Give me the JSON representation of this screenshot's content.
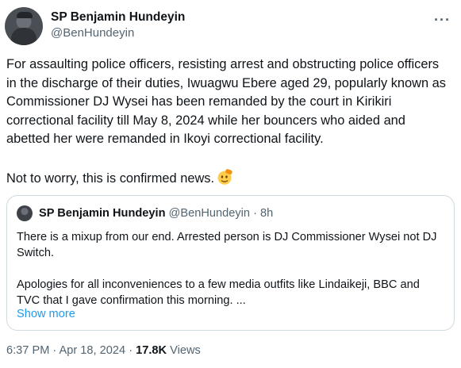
{
  "author": {
    "name": "SP Benjamin Hundeyin",
    "handle": "@BenHundeyin",
    "more_icon": "more-horizontal-icon"
  },
  "tweet": {
    "text": "For assaulting police officers, resisting arrest and obstructing police officers in the discharge of their duties, Iwuagwu Ebere aged 29, popularly known as Commissioner DJ Wysei has been remanded by the court in Kirikiri correctional facility till May 8, 2024 while her bouncers who aided and abetted her were remanded in Ikoyi correctional facility.\n\nNot to worry, this is confirmed news.",
    "emoji": "saluting-face-emoji"
  },
  "quoted": {
    "name": "SP Benjamin Hundeyin",
    "handle": "@BenHundeyin",
    "separator": "·",
    "time": "8h",
    "text": "There is a mixup from our end. Arrested person is DJ Commissioner Wysei not DJ Switch.\n\nApologies for all inconveniences to a few media outfits like Lindaikeji, BBC and TVC that I gave confirmation this morning. ...",
    "show_more": "Show more"
  },
  "footer": {
    "time": "6:37 PM",
    "separator1": "·",
    "date": "Apr 18, 2024",
    "separator2": "·",
    "views_count": "17.8K",
    "views_label": "Views"
  },
  "colors": {
    "text": "#0f1419",
    "secondary": "#536471",
    "link": "#1d9bf0",
    "border": "#cfd9de"
  }
}
